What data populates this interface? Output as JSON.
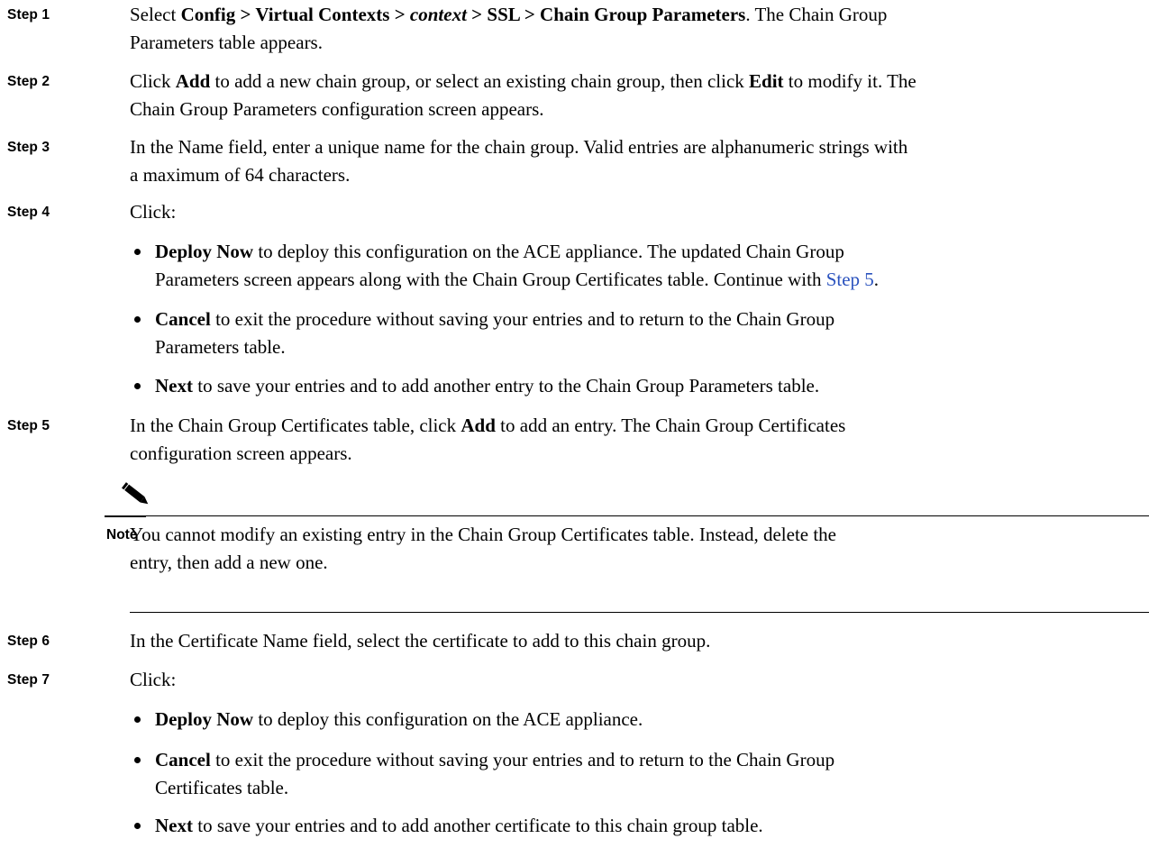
{
  "steps": [
    {
      "label": "Step 1"
    },
    {
      "label": "Step 2"
    },
    {
      "label": "Step 3"
    },
    {
      "label": "Step 4"
    },
    {
      "label": "Step 5"
    },
    {
      "label": "Step 6"
    },
    {
      "label": "Step 7"
    }
  ],
  "s1": {
    "select": "Select",
    "path": "Config > Virtual Contexts >",
    "context": "context",
    "path_end": "> SSL > Chain Group Parameters",
    "rest1": ". The Chain Group",
    "line2": "Parameters table appears."
  },
  "s2": {
    "click": "Click",
    "add": "Add",
    "mid": "to add a new chain group, or select an existing chain group, then click",
    "edit": "Edit",
    "tail": "to modify it. The",
    "line2": "Chain Group Parameters configuration screen appears."
  },
  "s3": {
    "line1": "In the Name field, enter a unique name for the chain group. Valid entries are alphanumeric strings with",
    "line2": "a maximum of 64 characters."
  },
  "s4": {
    "intro": "Click:",
    "b1_bold": "Deploy Now",
    "b1_l1": "to deploy this configuration on the ACE appliance. The updated Chain Group",
    "b1_l2": "Parameters screen appears along with the Chain Group Certificates table. Continue with",
    "b1_link": "Step 5",
    "b2_bold": "Cancel",
    "b2_l1": "to exit the procedure without saving your entries and to return to the Chain Group",
    "b2_l2": "Parameters table.",
    "b3_bold": "Next",
    "b3_l1": "to save your entries and to add another entry to the Chain Group Parameters table."
  },
  "s5": {
    "pre": "In the Chain Group Certificates table, click",
    "add": "Add",
    "post": "to add an entry. The Chain Group Certificates",
    "line2": "configuration screen appears."
  },
  "note": {
    "label": "Note",
    "line1": "You cannot modify an existing entry in the Chain Group Certificates table. Instead, delete the",
    "line2": "entry, then add a new one."
  },
  "s6": {
    "line1": "In the Certificate Name field, select the certificate to add to this chain group."
  },
  "s7": {
    "intro": "Click:",
    "b1_bold": "Deploy Now",
    "b1_l1": "to deploy this configuration on the ACE appliance.",
    "b2_bold": "Cancel",
    "b2_l1": "to exit the procedure without saving your entries and to return to the Chain Group",
    "b2_l2": "Certificates table.",
    "b3_bold": "Next",
    "b3_l1": "to save your entries and to add another certificate to this chain group table."
  }
}
